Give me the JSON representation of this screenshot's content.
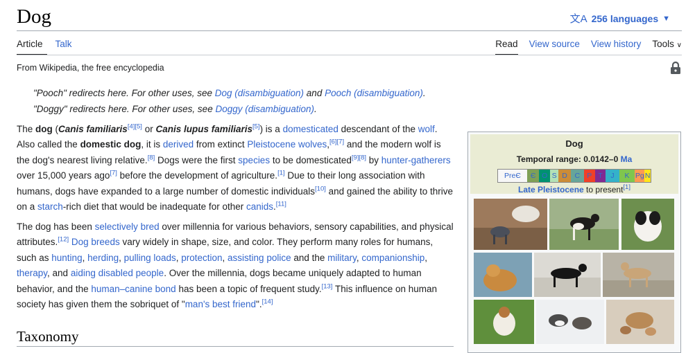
{
  "page": {
    "title": "Dog",
    "languages_label": "256 languages",
    "tabs_left": [
      "Article",
      "Talk"
    ],
    "tabs_right": [
      "Read",
      "View source",
      "View history"
    ],
    "tools_label": "Tools",
    "tagline": "From Wikipedia, the free encyclopedia"
  },
  "hatnotes": [
    {
      "text": "\"Pooch\" redirects here. For other uses, see ",
      "link1": "Dog (disambiguation)",
      "mid": " and ",
      "link2": "Pooch (disambiguation)",
      "end": "."
    },
    {
      "text": "\"Doggy\" redirects here. For other uses, see ",
      "link1": "Doggy (disambiguation)",
      "end": "."
    }
  ],
  "paragraph1": {
    "t1": "The ",
    "b1": "dog",
    "t2": " (",
    "bi1": "Canis familiaris",
    "s1": "[4][5]",
    "t3": " or ",
    "bi2": "Canis lupus familiaris",
    "s2": "[5]",
    "t4": ") is a ",
    "l1": "domesticated",
    "t5": " descendant of the ",
    "l2": "wolf",
    "t6": ". Also called the ",
    "b2": "domestic dog",
    "t7": ", it is ",
    "l3": "derived",
    "t8": " from extinct ",
    "l4": "Pleistocene wolves",
    "t9": ",",
    "s3": "[6][7]",
    "t10": " and the modern wolf is the dog's nearest living relative.",
    "s4": "[8]",
    "t11": " Dogs were the first ",
    "l5": "species",
    "t12": " to be domesticated",
    "s5": "[9][8]",
    "t13": " by ",
    "l6": "hunter-gatherers",
    "t14": " over 15,000 years ago",
    "s6": "[7]",
    "t15": " before the development of agriculture.",
    "s7": "[1]",
    "t16": " Due to their long association with humans, dogs have expanded to a large number of domestic individuals",
    "s8": "[10]",
    "t17": " and gained the ability to thrive on a ",
    "l7": "starch",
    "t18": "-rich diet that would be inadequate for other ",
    "l8": "canids",
    "t19": ".",
    "s9": "[11]"
  },
  "paragraph2": {
    "t1": "The dog has been ",
    "l1": "selectively bred",
    "t2": " over millennia for various behaviors, sensory capabilities, and physical attributes.",
    "s1": "[12]",
    "t3": " ",
    "l2": "Dog breeds",
    "t4": " vary widely in shape, size, and color. They perform many roles for humans, such as ",
    "l3": "hunting",
    "c1": ", ",
    "l4": "herding",
    "c2": ", ",
    "l5": "pulling loads",
    "c3": ", ",
    "l6": "protection",
    "c4": ", ",
    "l7": "assisting police",
    "t5": " and the ",
    "l8": "military",
    "c5": ", ",
    "l9": "companionship",
    "c6": ", ",
    "l10": "therapy",
    "t6": ", and ",
    "l11": "aiding disabled people",
    "t7": ". Over the millennia, dogs became uniquely adapted to human behavior, and the ",
    "l12": "human–canine bond",
    "t8": " has been a topic of frequent study.",
    "s2": "[13]",
    "t9": " This influence on human society has given them the sobriquet of \"",
    "l13": "man's best friend",
    "t10": "\".",
    "s3": "[14]"
  },
  "section_heading": "Taxonomy",
  "infobox": {
    "title": "Dog",
    "range_label": "Temporal range: 0.0142–0 ",
    "range_link": "Ma",
    "timebar": [
      {
        "label": "PreЄ",
        "color": "#f7f7f7"
      },
      {
        "label": "Є",
        "color": "#7fa056"
      },
      {
        "label": "O",
        "color": "#009270"
      },
      {
        "label": "S",
        "color": "#b3e1b6"
      },
      {
        "label": "D",
        "color": "#cb8c37"
      },
      {
        "label": "C",
        "color": "#67a599"
      },
      {
        "label": "P",
        "color": "#f04028"
      },
      {
        "label": "T",
        "color": "#812b92"
      },
      {
        "label": "J",
        "color": "#34b2c9"
      },
      {
        "label": "K",
        "color": "#7fc64e"
      },
      {
        "label": "Pg",
        "color": "#fd9a52"
      },
      {
        "label": "N",
        "color": "#ffe619"
      }
    ],
    "late_link": "Late Pleistocene",
    "late_text": " to present",
    "late_sup": "[1]"
  },
  "colors": {
    "link": "#3366cc",
    "text": "#202122",
    "infobox_head": "#eaecd4"
  }
}
